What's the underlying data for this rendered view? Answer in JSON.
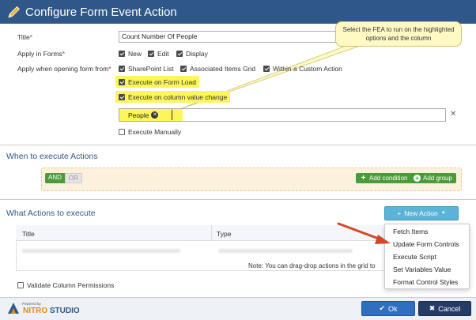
{
  "window": {
    "title": "Configure Form Event Action"
  },
  "form": {
    "title_label": "Title",
    "title_value": "Count Number Of People",
    "apply_forms_label": "Apply in Forms",
    "forms": [
      {
        "label": "New",
        "checked": true
      },
      {
        "label": "Edit",
        "checked": true
      },
      {
        "label": "Display",
        "checked": true
      }
    ],
    "apply_opening_label": "Apply when opening form from",
    "opening_sources": [
      {
        "label": "SharePoint List",
        "checked": true
      },
      {
        "label": "Associated Items Grid",
        "checked": true
      },
      {
        "label": "Within a Custom Action",
        "checked": true
      }
    ],
    "execute_on_form_load": "Execute on Form Load",
    "execute_on_column_change": "Execute on column value change",
    "column_tag": "People",
    "execute_manually": "Execute Manually"
  },
  "when_section": {
    "title": "When to execute Actions",
    "and_label": "AND",
    "or_label": "OR",
    "add_condition": "Add condition",
    "add_group": "Add group"
  },
  "what_section": {
    "title": "What Actions to execute",
    "new_action": "New Action",
    "columns": [
      "Title",
      "Type"
    ],
    "note": "Note: You can drag-drop actions in the grid to"
  },
  "menu": {
    "items": [
      "Fetch Items",
      "Update Form Controls",
      "Execute Script",
      "Set Variables Value",
      "Format Control Styles"
    ]
  },
  "validate_label": "Validate Column Permissions",
  "tooltip": "Select the FEA to run on the highlighted options and the column",
  "footer": {
    "powered_by": "Powered by",
    "brand_first": "NITRO",
    "brand_second": "STUDIO",
    "ok": "Ok",
    "cancel": "Cancel"
  },
  "colors": {
    "header": "#2f5788",
    "highlight": "#fdf65a",
    "green": "#4b9b3a",
    "arrow": "#d04a2a"
  }
}
